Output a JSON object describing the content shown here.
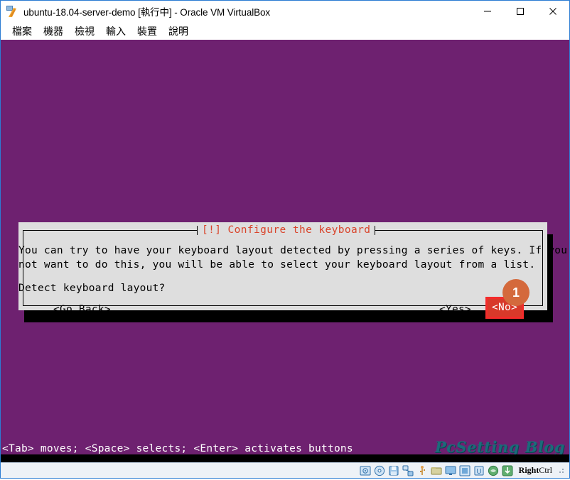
{
  "window": {
    "title": "ubuntu-18.04-server-demo [執行中] - Oracle VM VirtualBox",
    "app_icon": "virtualbox-icon",
    "controls": {
      "minimize": "minimize-icon",
      "maximize": "maximize-icon",
      "close": "close-icon"
    }
  },
  "menu": {
    "items": [
      {
        "label": "檔案"
      },
      {
        "label": "機器"
      },
      {
        "label": "檢視"
      },
      {
        "label": "輸入"
      },
      {
        "label": "裝置"
      },
      {
        "label": "說明"
      }
    ]
  },
  "guest": {
    "background_color": "#6e2170",
    "dialog": {
      "title": "[!] Configure the keyboard",
      "title_color": "#d9442b",
      "background_color": "#dedede",
      "body_line1": "You can try to have your keyboard layout detected by pressing a series of keys. If you do",
      "body_line2": "not want to do this, you will be able to select your keyboard layout from a list.",
      "question": "Detect keyboard layout?",
      "buttons": {
        "go_back": "<Go Back>",
        "yes": "<Yes>",
        "no": "<No>"
      },
      "highlight_color": "#f42b2b",
      "selected_button_fill": "#d8392a"
    },
    "hint": "<Tab> moves; <Space> selects; <Enter> activates buttons",
    "watermark": "PcSetting Blog",
    "watermark_color": "#1b6b7a"
  },
  "annotation": {
    "badge_number": "1",
    "badge_color": "#d4693c"
  },
  "status_bar": {
    "icons": [
      {
        "name": "hard-disk-icon",
        "color": "#3c7fbf"
      },
      {
        "name": "optical-disk-icon",
        "color": "#4a90c4"
      },
      {
        "name": "floppy-disk-icon",
        "color": "#5a9fd4"
      },
      {
        "name": "network-icon",
        "color": "#4a86c8"
      },
      {
        "name": "usb-icon",
        "color": "#d4954a"
      },
      {
        "name": "shared-folder-icon",
        "color": "#c8b44a"
      },
      {
        "name": "display-icon",
        "color": "#4a9fd4"
      },
      {
        "name": "recording-icon",
        "color": "#5a8fc4"
      },
      {
        "name": "virtualization-icon",
        "color": "#4a90c4"
      },
      {
        "name": "mouse-integration-icon",
        "color": "#4aa85a"
      },
      {
        "name": "host-key-icon",
        "color": "#3c8f4a"
      }
    ],
    "host_key_label_bold": "Right",
    "host_key_label": "Ctrl"
  }
}
